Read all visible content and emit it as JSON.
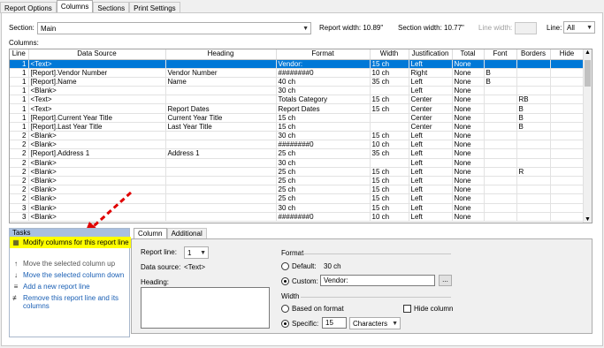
{
  "tabs": [
    "Report Options",
    "Columns",
    "Sections",
    "Print Settings"
  ],
  "active_tab": "Columns",
  "section": {
    "label": "Section:",
    "value": "Main"
  },
  "report_width": "Report width: 10.89\"",
  "section_width": "Section width: 10.77\"",
  "line_width_label": "Line width:",
  "line": {
    "label": "Line:",
    "value": "All"
  },
  "columns_label": "Columns:",
  "headers": [
    "Line",
    "Data Source",
    "Heading",
    "Format",
    "Width",
    "Justification",
    "Total",
    "Font",
    "Borders",
    "Hide"
  ],
  "rows": [
    [
      "1",
      "<Text>",
      "",
      "Vendor:",
      "15 ch",
      "Left",
      "None",
      "",
      "",
      ""
    ],
    [
      "1",
      "[Report].Vendor Number",
      "Vendor Number",
      "########0",
      "10 ch",
      "Right",
      "None",
      "B",
      "",
      ""
    ],
    [
      "1",
      "[Report].Name",
      "Name",
      "40 ch",
      "35 ch",
      "Left",
      "None",
      "B",
      "",
      ""
    ],
    [
      "1",
      "<Blank>",
      "",
      "30 ch",
      "",
      "Left",
      "None",
      "",
      "",
      ""
    ],
    [
      "1",
      "<Text>",
      "",
      "Totals Category",
      "15 ch",
      "Center",
      "None",
      "",
      "RB",
      ""
    ],
    [
      "1",
      "<Text>",
      "Report Dates",
      "Report Dates",
      "15 ch",
      "Center",
      "None",
      "",
      "B",
      ""
    ],
    [
      "1",
      "[Report].Current Year Title",
      "Current Year Title",
      "15 ch",
      "",
      "Center",
      "None",
      "",
      "B",
      ""
    ],
    [
      "1",
      "[Report].Last Year Title",
      "Last Year Title",
      "15 ch",
      "",
      "Center",
      "None",
      "",
      "B",
      ""
    ],
    [
      "2",
      "<Blank>",
      "",
      "30 ch",
      "15 ch",
      "Left",
      "None",
      "",
      "",
      ""
    ],
    [
      "2",
      "<Blank>",
      "",
      "########0",
      "10 ch",
      "Left",
      "None",
      "",
      "",
      ""
    ],
    [
      "2",
      "[Report].Address 1",
      "Address 1",
      "25 ch",
      "35 ch",
      "Left",
      "None",
      "",
      "",
      ""
    ],
    [
      "2",
      "<Blank>",
      "",
      "30 ch",
      "",
      "Left",
      "None",
      "",
      "",
      ""
    ],
    [
      "2",
      "<Blank>",
      "",
      "25 ch",
      "15 ch",
      "Left",
      "None",
      "",
      "R",
      ""
    ],
    [
      "2",
      "<Blank>",
      "",
      "25 ch",
      "15 ch",
      "Left",
      "None",
      "",
      "",
      ""
    ],
    [
      "2",
      "<Blank>",
      "",
      "25 ch",
      "15 ch",
      "Left",
      "None",
      "",
      "",
      ""
    ],
    [
      "2",
      "<Blank>",
      "",
      "25 ch",
      "15 ch",
      "Left",
      "None",
      "",
      "",
      ""
    ],
    [
      "3",
      "<Blank>",
      "",
      "30 ch",
      "15 ch",
      "Left",
      "None",
      "",
      "",
      ""
    ],
    [
      "3",
      "<Blank>",
      "",
      "########0",
      "10 ch",
      "Left",
      "None",
      "",
      "",
      ""
    ]
  ],
  "tasks": {
    "header": "Tasks",
    "items": [
      {
        "label": "Modify columns for this report line",
        "icon": "edit-columns-icon"
      },
      {
        "label": "Move the selected column up",
        "icon": "arrow-up-icon"
      },
      {
        "label": "Move the selected column down",
        "icon": "arrow-down-icon"
      },
      {
        "label": "Add a new report line",
        "icon": "add-line-icon"
      },
      {
        "label": "Remove this report line and its columns",
        "icon": "remove-line-icon"
      }
    ]
  },
  "detail_tabs": [
    "Column",
    "Additional"
  ],
  "detail": {
    "report_line_label": "Report line:",
    "report_line_value": "1",
    "data_source_label": "Data source:",
    "data_source_value": "<Text>",
    "heading_label": "Heading:",
    "format_label": "Format",
    "default_label": "Default:",
    "default_value": "30 ch",
    "custom_label": "Custom:",
    "custom_value": "Vendor:",
    "browse_label": "...",
    "width_label": "Width",
    "based_on_format_label": "Based on format",
    "hide_column_label": "Hide column",
    "specific_label": "Specific:",
    "specific_value": "15",
    "unit_value": "Characters"
  },
  "colors": {
    "selection": "#0078d7",
    "highlight": "#ffff00",
    "annotation_arrow": "#e00000",
    "task_header": "#a9c0e0"
  }
}
